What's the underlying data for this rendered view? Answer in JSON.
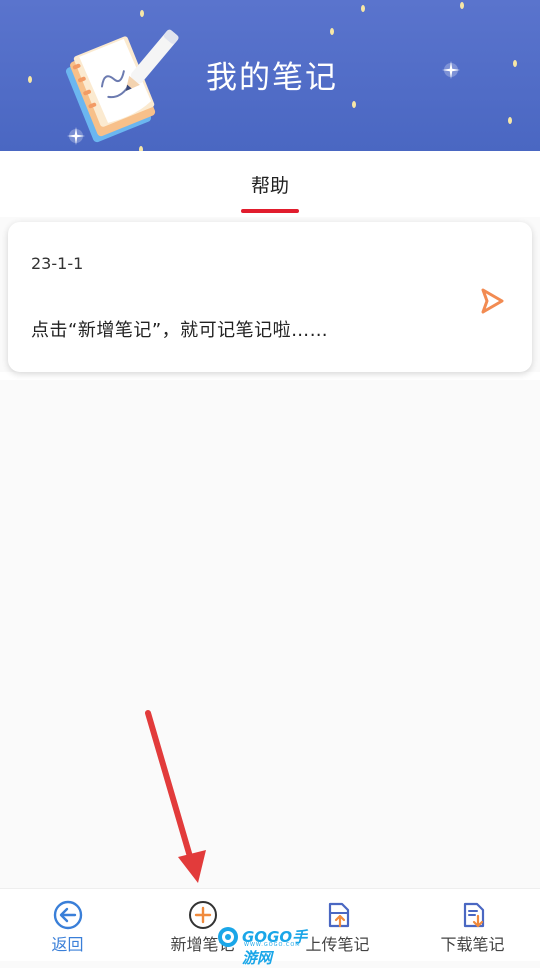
{
  "header": {
    "title": "我的笔记",
    "bg_color": "#4f6cc7"
  },
  "tabs": [
    {
      "label": "帮助",
      "active": true
    }
  ],
  "notes": [
    {
      "date": "23-1-1",
      "excerpt": "点击“新增笔记”，就可记笔记啦……"
    }
  ],
  "bottom_nav": {
    "items": [
      {
        "label": "返回",
        "icon": "back-arrow-circle-icon",
        "active": true
      },
      {
        "label": "新增笔记",
        "icon": "plus-circle-icon",
        "active": false
      },
      {
        "label": "上传笔记",
        "icon": "upload-note-icon",
        "active": false
      },
      {
        "label": "下载笔记",
        "icon": "download-note-icon",
        "active": false
      }
    ]
  },
  "watermark": {
    "text": "GOGO手游网",
    "sub": "WWW.GOGO.COM"
  },
  "colors": {
    "accent_red": "#e11d2d",
    "play_orange": "#f28b52",
    "nav_active_blue": "#3a7fd8",
    "annotation_red": "#e23b3b"
  }
}
